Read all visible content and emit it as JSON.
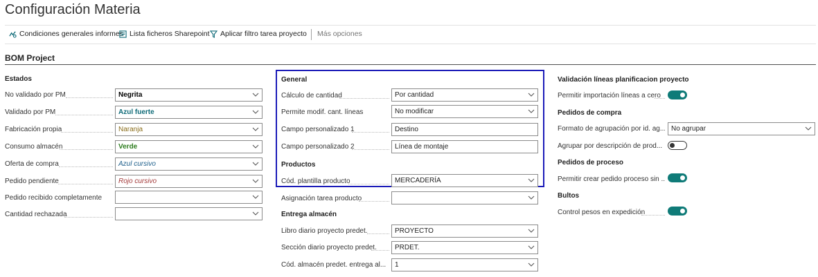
{
  "page": {
    "title": "Configuración Materia"
  },
  "actions": {
    "condiciones": "Condiciones generales informes",
    "lista": "Lista ficheros Sharepoint",
    "filtro": "Aplicar filtro tarea proyecto",
    "mas": "Más opciones"
  },
  "section": {
    "title": "BOM Project"
  },
  "estados": {
    "header": "Estados",
    "fields": [
      {
        "label": "No validado por PM",
        "value": "Negrita"
      },
      {
        "label": "Validado por PM",
        "value": "Azul fuerte"
      },
      {
        "label": "Fabricación propia",
        "value": "Naranja"
      },
      {
        "label": "Consumo almacén",
        "value": "Verde"
      },
      {
        "label": "Oferta de compra",
        "value": "Azul cursivo"
      },
      {
        "label": "Pedido pendiente",
        "value": "Rojo cursivo"
      },
      {
        "label": "Pedido recibido completamente",
        "value": ""
      },
      {
        "label": "Cantidad rechazada",
        "value": ""
      }
    ]
  },
  "general": {
    "header": "General",
    "fields": [
      {
        "label": "Cálculo de cantidad",
        "value": "Por cantidad"
      },
      {
        "label": "Permite modif. cant. líneas",
        "value": "No modificar"
      },
      {
        "label": "Campo personalizado 1",
        "value": "Destino"
      },
      {
        "label": "Campo personalizado 2",
        "value": "Línea de montaje"
      }
    ]
  },
  "productos": {
    "header": "Productos",
    "fields": [
      {
        "label": "Cód. plantilla producto",
        "value": "MERCADERÍA"
      },
      {
        "label": "Asignación tarea producto",
        "value": ""
      }
    ]
  },
  "entrega": {
    "header": "Entrega almacén",
    "fields": [
      {
        "label": "Libro diario proyecto predet.",
        "value": "PROYECTO"
      },
      {
        "label": "Sección diario proyecto predet.",
        "value": "PRDET."
      },
      {
        "label": "Cód. almacén predet. entrega al...",
        "value": "1"
      }
    ]
  },
  "validacion": {
    "header": "Validación líneas planificacion proyecto",
    "fields": [
      {
        "label": "Permitir importación líneas a cero",
        "on": true
      }
    ]
  },
  "pedidos_compra": {
    "header": "Pedidos de compra",
    "formato_label": "Formato de agrupación por id. ag...",
    "formato_value": "No agrupar",
    "agrupar_label": "Agrupar por descripción de prod...",
    "agrupar_on": false
  },
  "pedidos_proceso": {
    "header": "Pedidos de proceso",
    "label": "Permitir crear pedido proceso sin ...",
    "on": true
  },
  "bultos": {
    "header": "Bultos",
    "label": "Control pesos en expedición",
    "on": true
  },
  "colors": {
    "accent": "#0f7b78",
    "highlight": "#1a1ab8"
  }
}
